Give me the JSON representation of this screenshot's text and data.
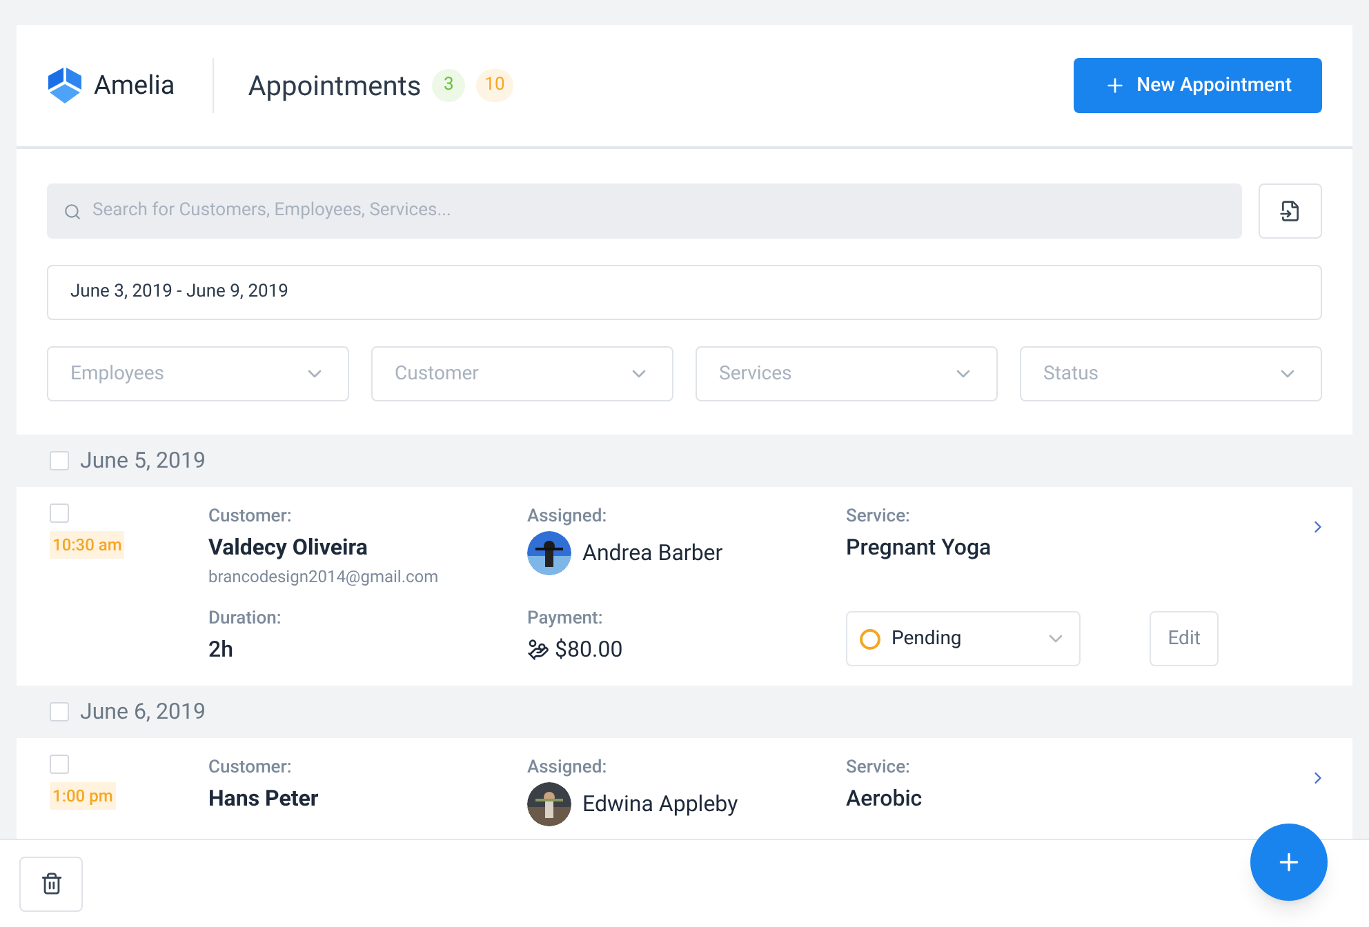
{
  "header": {
    "brand": "Amelia",
    "title": "Appointments",
    "badges": [
      {
        "text": "3",
        "color": "#67c23a"
      },
      {
        "text": "10",
        "color": "#f5a623"
      }
    ],
    "new_button": "New Appointment"
  },
  "filters": {
    "search": {
      "placeholder": "Search for Customers, Employees, Services..."
    },
    "date_range": "June 3, 2019 - June 9, 2019",
    "dropdowns": [
      {
        "placeholder": "Employees"
      },
      {
        "placeholder": "Customer"
      },
      {
        "placeholder": "Services"
      },
      {
        "placeholder": "Status"
      }
    ]
  },
  "days": [
    {
      "date": "June 5, 2019",
      "checked": false,
      "appointments": [
        {
          "checked": false,
          "time": "10:30 am",
          "customer_label": "Customer:",
          "customer": "Valdecy Oliveira",
          "email": "brancodesign2014@gmail.com",
          "assigned_label": "Assigned:",
          "employee": "Andrea Barber",
          "service_label": "Service:",
          "service": "Pregnant Yoga",
          "duration_label": "Duration:",
          "duration": "2h",
          "payment_label": "Payment:",
          "payment": "$80.00",
          "status": {
            "text": "Pending",
            "color": "#f5a623"
          },
          "edit": "Edit"
        }
      ]
    },
    {
      "date": "June 6, 2019",
      "checked": false,
      "appointments": [
        {
          "checked": false,
          "time": "1:00 pm",
          "customer_label": "Customer:",
          "customer": "Hans Peter",
          "assigned_label": "Assigned:",
          "employee": "Edwina Appleby",
          "service_label": "Service:",
          "service": "Aerobic"
        }
      ]
    }
  ]
}
